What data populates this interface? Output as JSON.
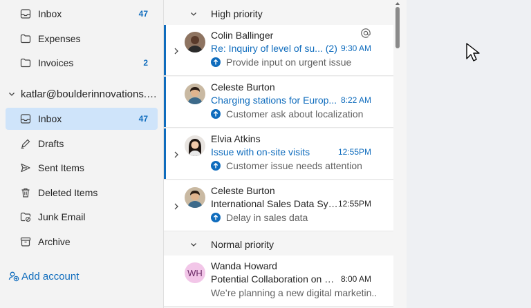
{
  "sidebar": {
    "top_folders": [
      {
        "name": "Inbox",
        "count": "47",
        "icon": "inbox-icon"
      },
      {
        "name": "Expenses",
        "count": "",
        "icon": "folder-icon"
      },
      {
        "name": "Invoices",
        "count": "2",
        "icon": "folder-icon"
      }
    ],
    "account": "katlar@boulderinnovations.com",
    "folders": [
      {
        "name": "Inbox",
        "count": "47",
        "icon": "inbox-icon",
        "selected": true
      },
      {
        "name": "Drafts",
        "count": "",
        "icon": "pencil-icon"
      },
      {
        "name": "Sent Items",
        "count": "",
        "icon": "send-icon"
      },
      {
        "name": "Deleted Items",
        "count": "",
        "icon": "trash-icon"
      },
      {
        "name": "Junk Email",
        "count": "",
        "icon": "junk-folder-icon"
      },
      {
        "name": "Archive",
        "count": "",
        "icon": "archive-icon"
      }
    ],
    "add_account": "Add account"
  },
  "message_list": {
    "high_priority_label": "High priority",
    "normal_priority_label": "Normal priority",
    "messages": [
      {
        "sender": "Colin Ballinger",
        "subject": "Re: Inquiry of level of su... (2)",
        "time": "9:30 AM",
        "preview": "Provide input on urgent issue",
        "unread": true,
        "mention": true
      },
      {
        "sender": "Celeste Burton",
        "subject": "Charging stations for Europ...",
        "time": "8:22 AM",
        "preview": "Customer ask about localization",
        "unread": true
      },
      {
        "sender": "Elvia Atkins",
        "subject": "Issue with on-site visits",
        "time": "12:55PM",
        "preview": "Customer issue needs attention",
        "unread": true
      },
      {
        "sender": "Celeste Burton",
        "subject": "International Sales Data Sync D...",
        "time": "12:55PM",
        "preview": "Delay in sales data",
        "unread": false
      }
    ],
    "normal_messages": [
      {
        "sender": "Wanda Howard",
        "initials": "WH",
        "subject": "Potential Collaboration on Digit...",
        "time": "8:00 AM",
        "preview": "We’re planning a new digital marketin...",
        "unread": false
      }
    ]
  },
  "colors": {
    "accent": "#0f6cbd",
    "selected_bg": "#cfe4fa"
  }
}
